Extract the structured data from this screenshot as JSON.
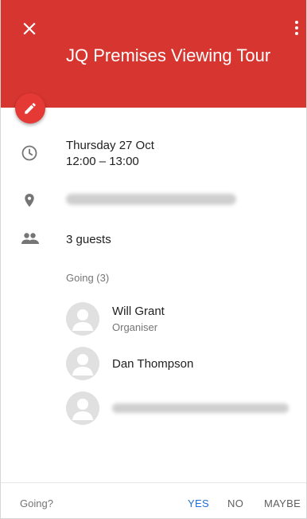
{
  "header": {
    "title": "JQ Premises Viewing Tour",
    "color": "#d6362f",
    "close_icon": "close-icon",
    "more_icon": "more-vert-icon",
    "edit_icon": "pencil-icon"
  },
  "event": {
    "date": "Thursday 27 Oct",
    "time": "12:00 – 13:00",
    "location_hidden": true
  },
  "guests": {
    "count_label": "3 guests",
    "going_header": "Going (3)",
    "list": [
      {
        "name": "Will Grant",
        "role": "Organiser"
      },
      {
        "name": "Dan Thompson",
        "role": ""
      },
      {
        "name": "",
        "role": ""
      }
    ]
  },
  "footer": {
    "question": "Going?",
    "yes": "YES",
    "no": "NO",
    "maybe": "MAYBE",
    "selected": "YES",
    "accent": "#1e6fd9"
  }
}
